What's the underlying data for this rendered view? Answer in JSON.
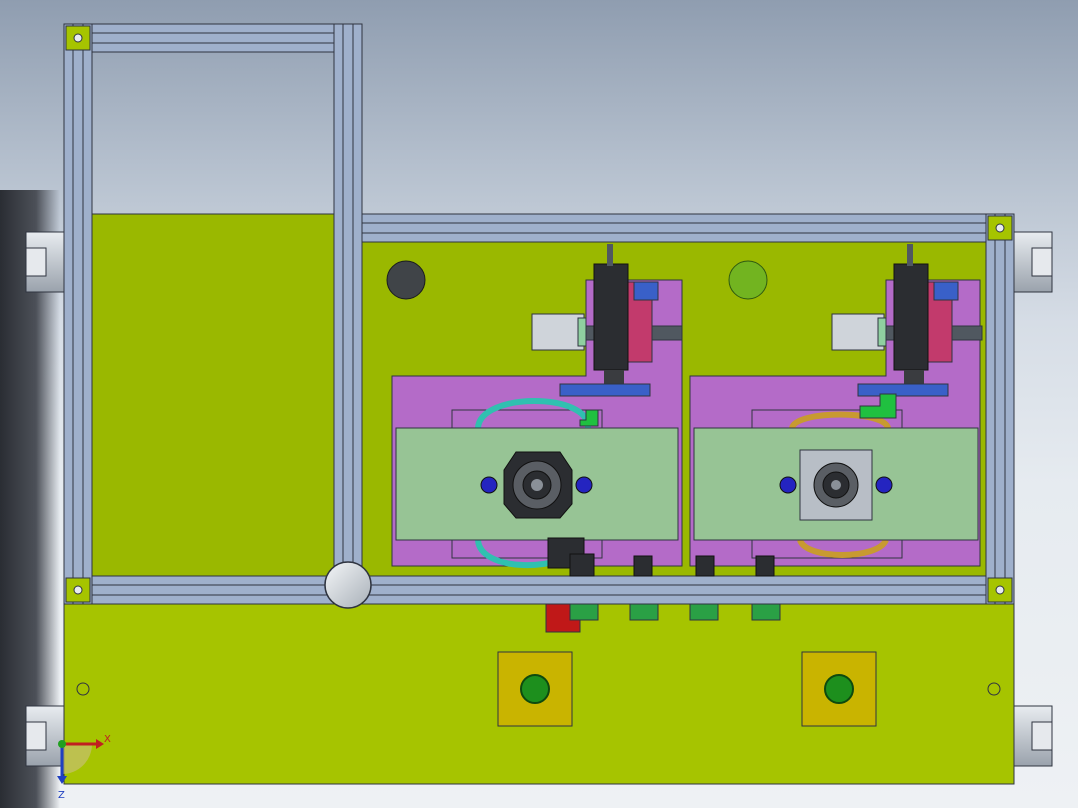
{
  "viewport": {
    "background_top": "#8f9db0",
    "background_bottom": "#eef1f4"
  },
  "colors": {
    "frame_profile": "#9fb0cc",
    "frame_edge": "#2f3440",
    "base_plate": "#9ab800",
    "lower_plate": "#a6c400",
    "bracket_plate": "#b46bc8",
    "mount_plate": "#97c495",
    "steel": "#b8bec6",
    "dark_part": "#2b2d31",
    "slider": "#cfd4da",
    "rail_red": "#c23a6c",
    "rail_blue": "#3960c8",
    "bolt_blue": "#2424c0",
    "button_green": "#1d8f1d",
    "button_box": "#c9b400",
    "connector_green": "#2aa045",
    "connector_red": "#c01818",
    "sensor_dark": "#404448",
    "sensor_green": "#72b420",
    "hose_cyan": "#30c0b0",
    "gear_gold": "#c89a30"
  },
  "icons": {
    "triad": "axis-triad-icon",
    "corner": "corner-connector-icon",
    "button": "push-button-icon"
  },
  "triad": {
    "x_label": "X",
    "z_label": "Z"
  }
}
